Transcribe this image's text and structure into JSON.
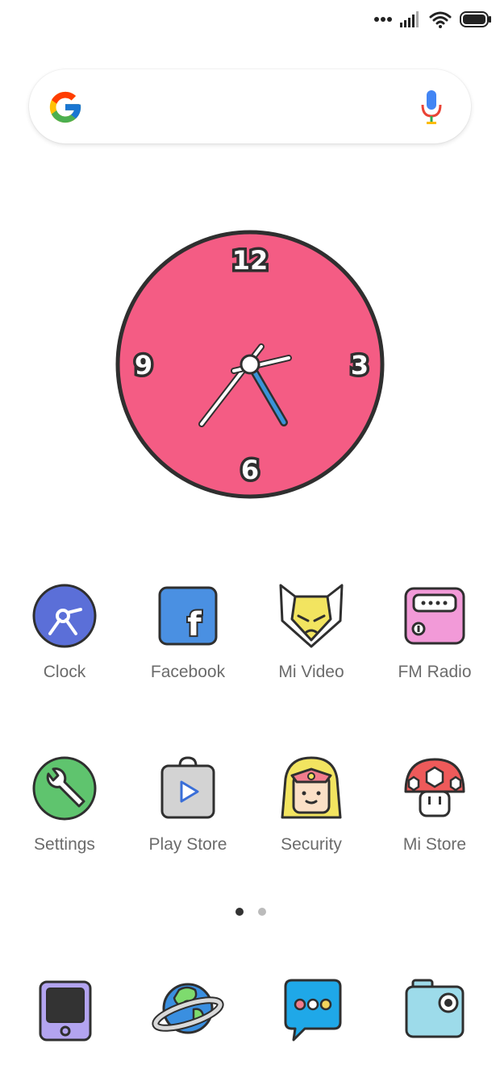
{
  "status_bar": {
    "icons": [
      "more-dots-icon",
      "signal-icon",
      "wifi-icon",
      "battery-icon"
    ]
  },
  "search": {
    "logo": "google-g-icon",
    "voice": "microphone-icon"
  },
  "clock": {
    "numerals": [
      "12",
      "3",
      "6",
      "9"
    ],
    "face_color": "#F45C84",
    "hour_hand_color": "#3A93D8"
  },
  "apps": [
    {
      "label": "Clock",
      "icon": "clock-app-icon"
    },
    {
      "label": "Facebook",
      "icon": "facebook-icon"
    },
    {
      "label": "Mi Video",
      "icon": "mi-video-icon"
    },
    {
      "label": "FM Radio",
      "icon": "fm-radio-icon"
    },
    {
      "label": "Settings",
      "icon": "settings-icon"
    },
    {
      "label": "Play Store",
      "icon": "play-store-icon"
    },
    {
      "label": "Security",
      "icon": "security-icon"
    },
    {
      "label": "Mi Store",
      "icon": "mi-store-icon"
    }
  ],
  "page_indicator": {
    "pages": 2,
    "current": 1
  },
  "dock": [
    {
      "icon": "phone-icon"
    },
    {
      "icon": "browser-planet-icon"
    },
    {
      "icon": "messages-icon"
    },
    {
      "icon": "camera-icon"
    }
  ]
}
